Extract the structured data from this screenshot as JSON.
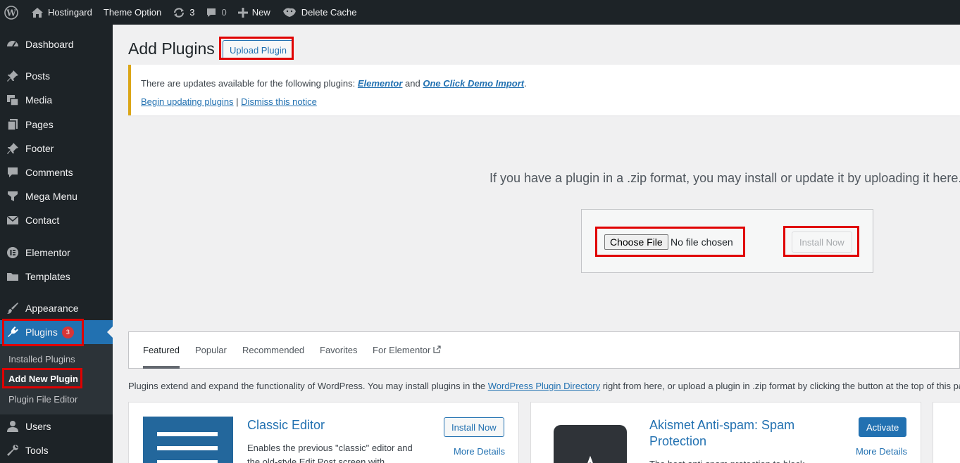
{
  "adminbar": {
    "site_name": "Hostingard",
    "theme_option": "Theme Option",
    "updates_count": "3",
    "comments_count": "0",
    "new_label": "New",
    "delete_cache": "Delete Cache"
  },
  "sidebar": {
    "items": [
      {
        "label": "Dashboard"
      },
      {
        "label": "Posts"
      },
      {
        "label": "Media"
      },
      {
        "label": "Pages"
      },
      {
        "label": "Footer"
      },
      {
        "label": "Comments"
      },
      {
        "label": "Mega Menu"
      },
      {
        "label": "Contact"
      },
      {
        "label": "Elementor"
      },
      {
        "label": "Templates"
      },
      {
        "label": "Appearance"
      },
      {
        "label": "Plugins",
        "badge": "3"
      },
      {
        "label": "Users"
      },
      {
        "label": "Tools"
      }
    ],
    "submenu": {
      "installed": "Installed Plugins",
      "add_new": "Add New Plugin",
      "file_editor": "Plugin File Editor"
    }
  },
  "main": {
    "title": "Add Plugins",
    "upload_button": "Upload Plugin",
    "notice": {
      "text_before": "There are updates available for the following plugins: ",
      "plugin1": "Elementor",
      "and": " and ",
      "plugin2": "One Click Demo Import",
      "period": ".",
      "begin_link": "Begin updating plugins",
      "separator": " | ",
      "dismiss_link": "Dismiss this notice"
    },
    "upload": {
      "help_text": "If you have a plugin in a .zip format, you may install or update it by uploading it here.",
      "choose_file": "Choose File",
      "no_file": "No file chosen",
      "install_now": "Install Now"
    },
    "tabs": [
      {
        "label": "Featured"
      },
      {
        "label": "Popular"
      },
      {
        "label": "Recommended"
      },
      {
        "label": "Favorites"
      },
      {
        "label": "For Elementor"
      }
    ],
    "description": {
      "before": "Plugins extend and expand the functionality of WordPress. You may install plugins in the ",
      "link": "WordPress Plugin Directory",
      "after": " right from here, or upload a plugin in .zip format by clicking the button at the top of this page."
    },
    "cards": [
      {
        "title": "Classic Editor",
        "description": "Enables the previous \"classic\" editor and the old-style Edit Post screen with",
        "action": "Install Now",
        "more": "More Details"
      },
      {
        "title": "Akismet Anti-spam: Spam Protection",
        "description": "The best anti-spam protection to block",
        "action": "Activate",
        "more": "More Details"
      }
    ]
  },
  "colors": {
    "adminbar_bg": "#1d2327",
    "accent": "#2271b1",
    "highlight_border": "#e00000",
    "notice_warning": "#dba617"
  }
}
